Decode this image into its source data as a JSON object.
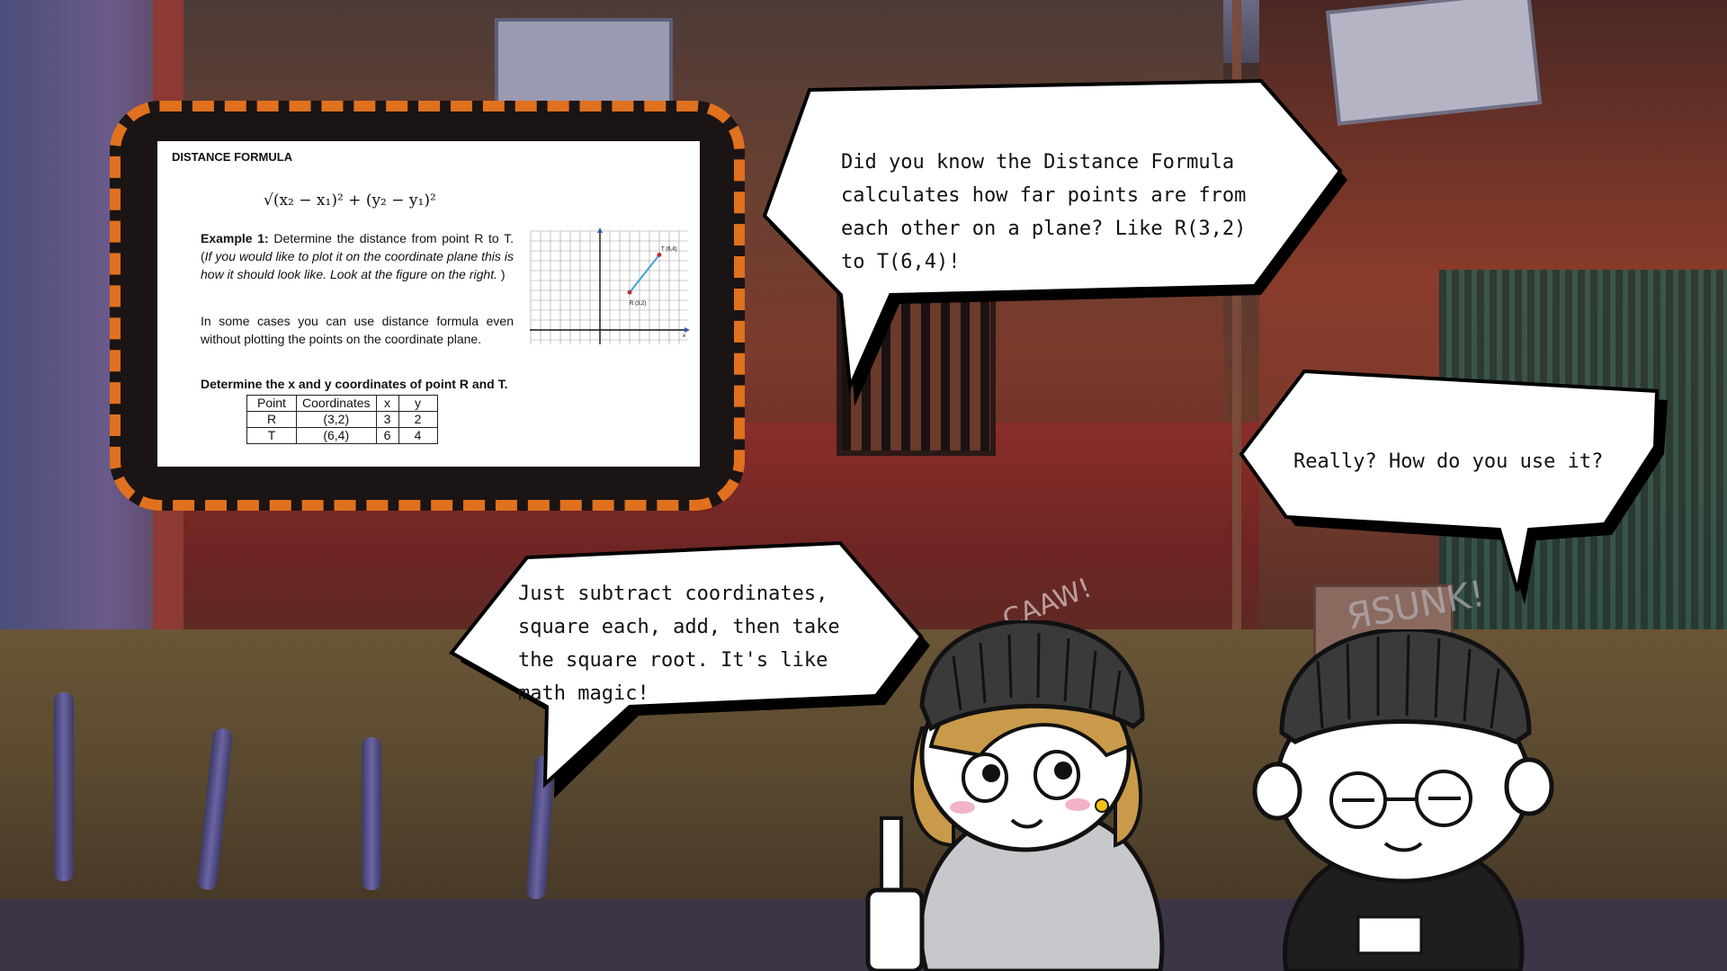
{
  "worksheet": {
    "title": "DISTANCE FORMULA",
    "formula": "√(x₂ − x₁)² + (y₂ − y₁)²",
    "example_label": "Example 1:",
    "example_text": " Determine the distance from point R to T. (",
    "example_italic": "If you would like to plot it on the coordinate plane this is how it should look like. Look at the figure on the right.",
    "example_close": " )",
    "case_text": "In some cases you can use distance formula even without plotting the points on the coordinate plane.",
    "determine_text": "Determine the x and y coordinates of point R and T.",
    "graph": {
      "point_t_label": "T (6,4)",
      "point_r_label": "R (3,2)",
      "x_axis_label": "x",
      "point_t": [
        6,
        4
      ],
      "point_r": [
        3,
        2
      ]
    },
    "table": {
      "headers": [
        "Point",
        "Coordinates",
        "x",
        "y"
      ],
      "rows": [
        [
          "R",
          "(3,2)",
          "3",
          "2"
        ],
        [
          "T",
          "(6,4)",
          "6",
          "4"
        ]
      ]
    }
  },
  "bubbles": {
    "top": "Did you know the Distance Formula\ncalculates how far points are from\neach other on a plane? Like R(3,2)\nto T(6,4)!",
    "right": "Really? How do you use it?",
    "bottom": " Just subtract coordinates,\nsquare each, add, then take\nthe square root. It's like\nmath magic!"
  },
  "graffiti": {
    "left": "CAAW!",
    "right": "ЯSUNK!"
  },
  "colors": {
    "frame": "#e0711e",
    "beanie": "#3a3a3a",
    "hoodie": "#c8c8cc"
  }
}
